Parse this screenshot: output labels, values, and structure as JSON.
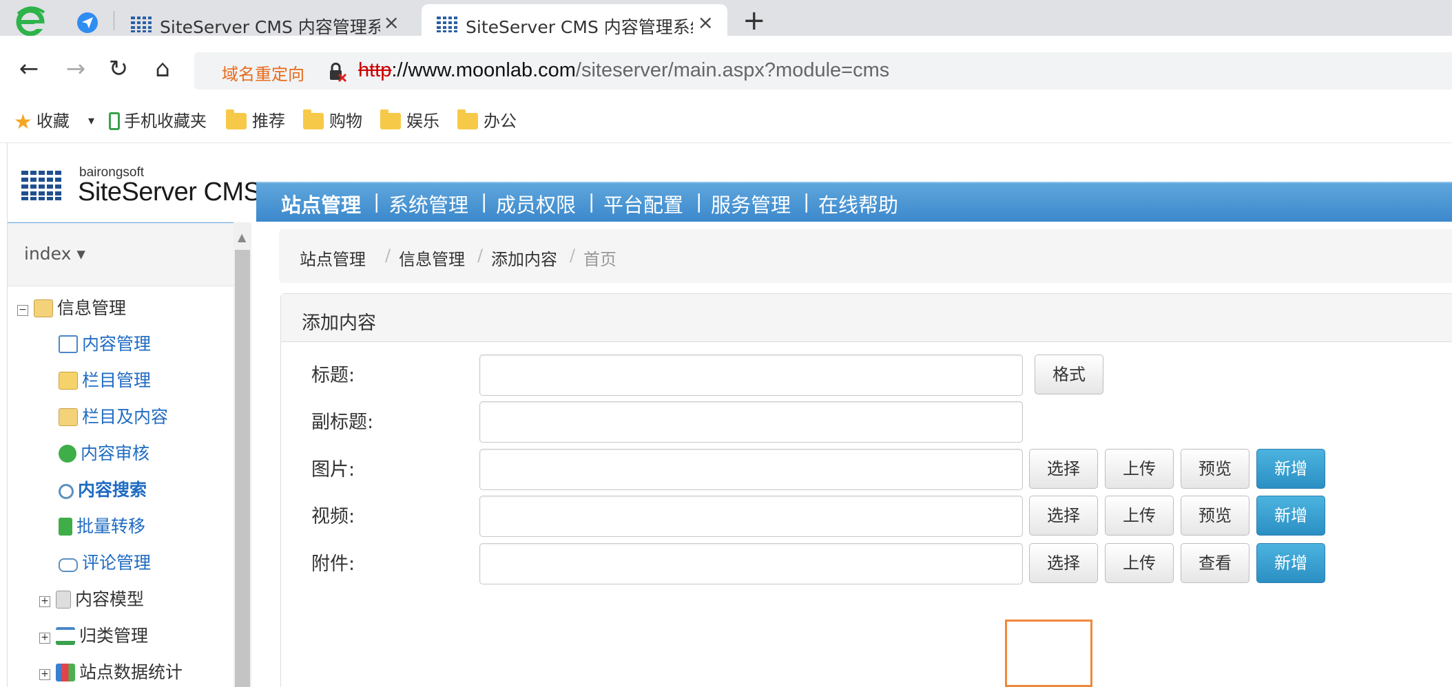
{
  "browser": {
    "tabs": [
      {
        "title": "SiteServer CMS 内容管理系统",
        "close": "×"
      },
      {
        "title": "SiteServer CMS 内容管理系统",
        "close": "×"
      }
    ],
    "new_tab": "+",
    "nav": {
      "back": "←",
      "forward": "→",
      "reload": "↻",
      "home": "⌂"
    },
    "redirect_label": "域名重定向",
    "url": {
      "protocol": "http",
      "host": "://www.moonlab.com",
      "path": "/siteserver/main.aspx?module=cms"
    },
    "bookmarks": {
      "favorites": "收藏",
      "caret": "▾",
      "mobile": "手机收藏夹",
      "folders": [
        "推荐",
        "购物",
        "娱乐",
        "办公"
      ]
    }
  },
  "cms": {
    "logo_small": "bairongsoft",
    "logo_big": "SiteServer CMS",
    "top_nav": [
      "站点管理",
      "系统管理",
      "成员权限",
      "平台配置",
      "服务管理",
      "在线帮助"
    ],
    "top_nav_sep": "|",
    "site_selector": "index ▾",
    "tree": {
      "root": "信息管理",
      "root_expander": "−",
      "children": [
        "内容管理",
        "栏目管理",
        "栏目及内容",
        "内容审核",
        "内容搜索",
        "批量转移",
        "评论管理"
      ],
      "collapsed": [
        "内容模型",
        "归类管理",
        "站点数据统计"
      ],
      "collapsed_expander": "+"
    },
    "scroll_up": "▲",
    "breadcrumb": [
      "站点管理",
      "信息管理",
      "添加内容",
      "首页"
    ],
    "breadcrumb_sep": "/",
    "panel_title": "添加内容",
    "form": {
      "title_label": "标题:",
      "format_button": "格式",
      "subtitle_label": "副标题:",
      "image_label": "图片:",
      "video_label": "视频:",
      "attachment_label": "附件:",
      "select": "选择",
      "upload": "上传",
      "preview": "预览",
      "view": "查看",
      "add": "新增"
    }
  },
  "colors": {
    "nav_blue": "#3b88cc",
    "primary_button": "#2b8fc3",
    "link": "#1f6bc2",
    "highlight": "#f0883a"
  }
}
